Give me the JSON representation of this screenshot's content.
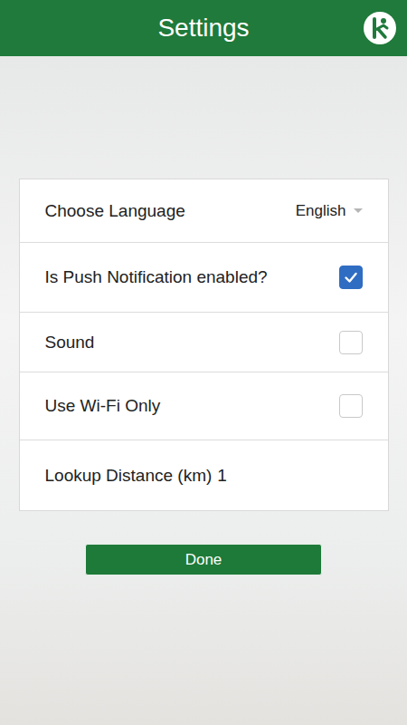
{
  "header": {
    "title": "Settings"
  },
  "settings": [
    {
      "kind": "select",
      "label": "Choose Language",
      "value": "English"
    },
    {
      "kind": "checkbox",
      "label": "Is Push Notification enabled?",
      "checked": true
    },
    {
      "kind": "checkbox",
      "label": "Sound",
      "checked": false
    },
    {
      "kind": "checkbox",
      "label": "Use Wi-Fi Only",
      "checked": false
    },
    {
      "kind": "text",
      "label": "Lookup Distance (km)",
      "value": "1"
    }
  ],
  "buttons": [
    "Done"
  ]
}
